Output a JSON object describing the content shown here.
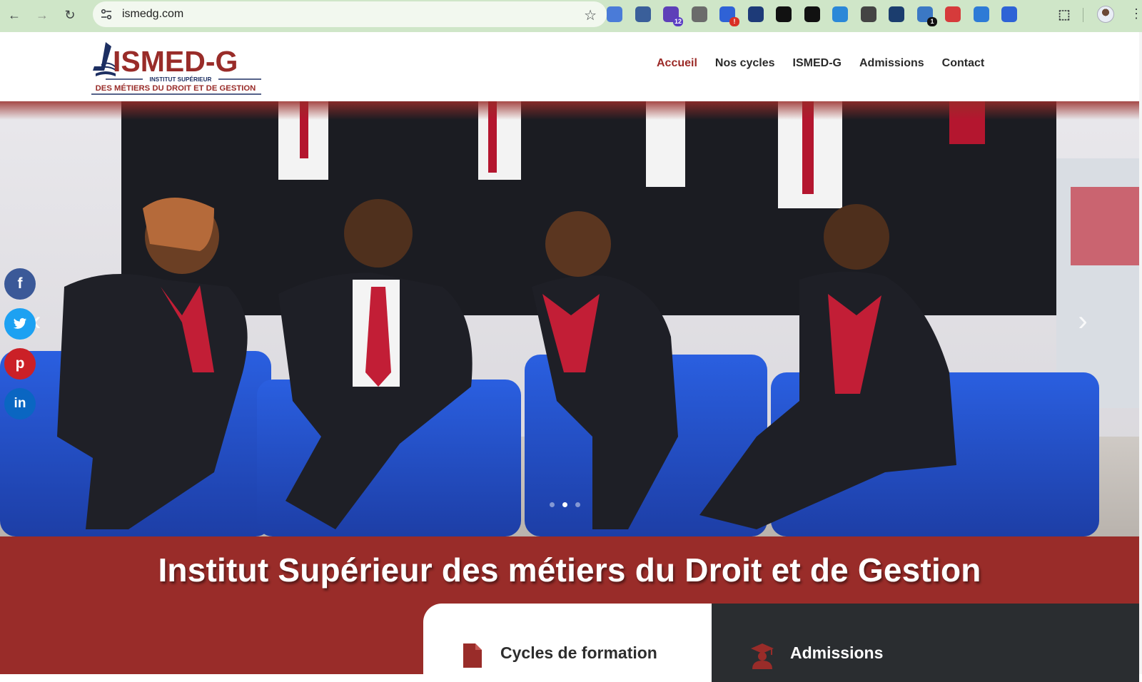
{
  "browser": {
    "url": "ismedg.com",
    "extensions": [
      {
        "name": "extension-1",
        "color": "#4a7bd8"
      },
      {
        "name": "extension-2",
        "color": "#3a5f9a"
      },
      {
        "name": "extension-3",
        "color": "#5e3fb8",
        "badge": "12",
        "badge_color": "#5b3cc4"
      },
      {
        "name": "extension-4",
        "color": "#6b6b6b"
      },
      {
        "name": "extension-5",
        "color": "#2f62d6",
        "badge": "!",
        "badge_color": "#d93025"
      },
      {
        "name": "extension-6",
        "color": "#1d3a78"
      },
      {
        "name": "extension-7",
        "color": "#111111"
      },
      {
        "name": "extension-8",
        "color": "#111111"
      },
      {
        "name": "extension-9",
        "color": "#2b88d8"
      },
      {
        "name": "extension-10",
        "color": "#444444"
      },
      {
        "name": "extension-11",
        "color": "#1b3d6e"
      },
      {
        "name": "extension-12",
        "color": "#3b78c4",
        "badge": "1",
        "badge_color": "#111111"
      },
      {
        "name": "extension-13",
        "color": "#d63b3b"
      },
      {
        "name": "extension-14",
        "color": "#2e7bd6"
      },
      {
        "name": "extension-15",
        "color": "#2e63d6"
      }
    ]
  },
  "site": {
    "logo": {
      "name": "ISMED-G",
      "line1": "INSTITUT SUPÉRIEUR",
      "line2": "DES MÉTIERS DU DROIT ET DE GESTION"
    },
    "nav": [
      {
        "label": "Accueil",
        "active": true
      },
      {
        "label": "Nos cycles"
      },
      {
        "label": "ISMED-G"
      },
      {
        "label": "Admissions"
      },
      {
        "label": "Contact"
      }
    ],
    "colors": {
      "brand_red": "#992c29",
      "dark": "#2a2d30",
      "facebook": "#3b5998",
      "twitter": "#1da1f2",
      "pinterest": "#cb2027",
      "linkedin": "#0a66c2"
    }
  },
  "hero": {
    "slides_total": 3,
    "active_slide": 2
  },
  "social": [
    {
      "name": "facebook",
      "glyph": "f"
    },
    {
      "name": "twitter",
      "glyph": ""
    },
    {
      "name": "pinterest",
      "glyph": "p"
    },
    {
      "name": "linkedin",
      "glyph": "in"
    }
  ],
  "banner": {
    "title": "Institut Supérieur des métiers du Droit et de Gestion",
    "cards": [
      {
        "label": "Cycles de formation",
        "icon": "document-icon"
      },
      {
        "label": "Admissions",
        "icon": "graduate-icon"
      }
    ]
  }
}
